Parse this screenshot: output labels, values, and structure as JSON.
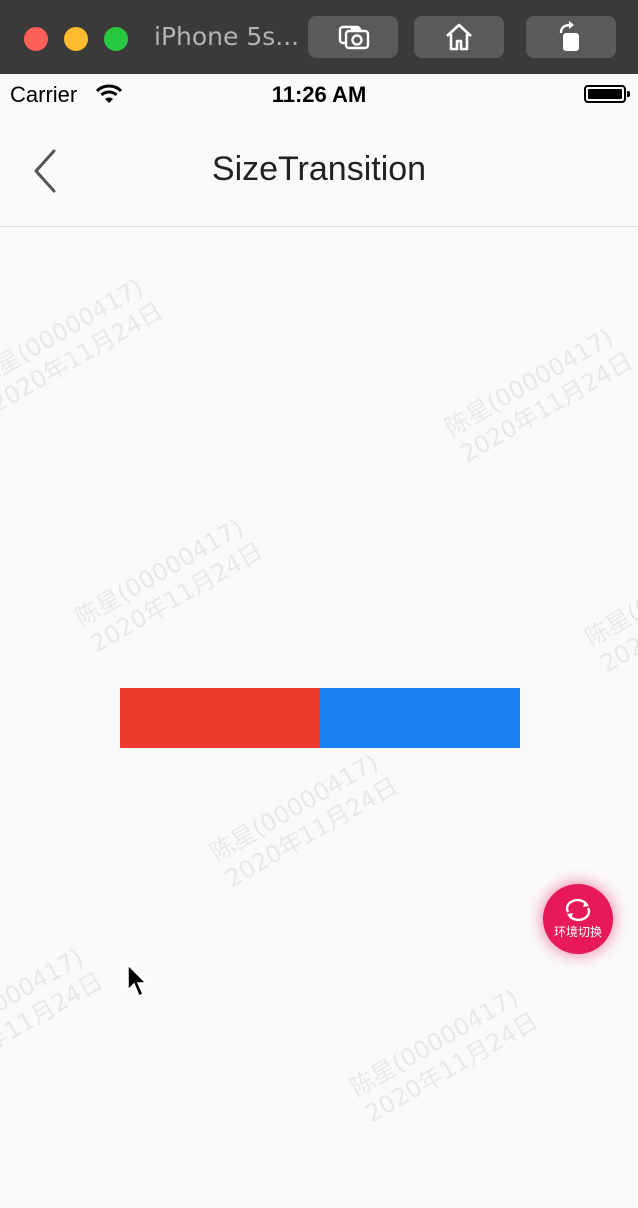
{
  "window": {
    "title": "iPhone 5s...",
    "toolbar_icons": [
      "camera-icon",
      "home-icon",
      "rotate-icon"
    ]
  },
  "status_bar": {
    "carrier": "Carrier",
    "time": "11:26 AM",
    "icons": [
      "wifi-icon",
      "battery-icon"
    ]
  },
  "nav": {
    "title": "SizeTransition",
    "back_icon": "chevron-left-icon"
  },
  "watermark": {
    "line1": "陈星(00000417)",
    "line2": "2020年11月24日"
  },
  "bars": {
    "left_color": "#ee3a2c",
    "right_color": "#1a82f0"
  },
  "fab": {
    "label": "环境切换",
    "icon": "refresh-icon",
    "color": "#e8195a"
  }
}
